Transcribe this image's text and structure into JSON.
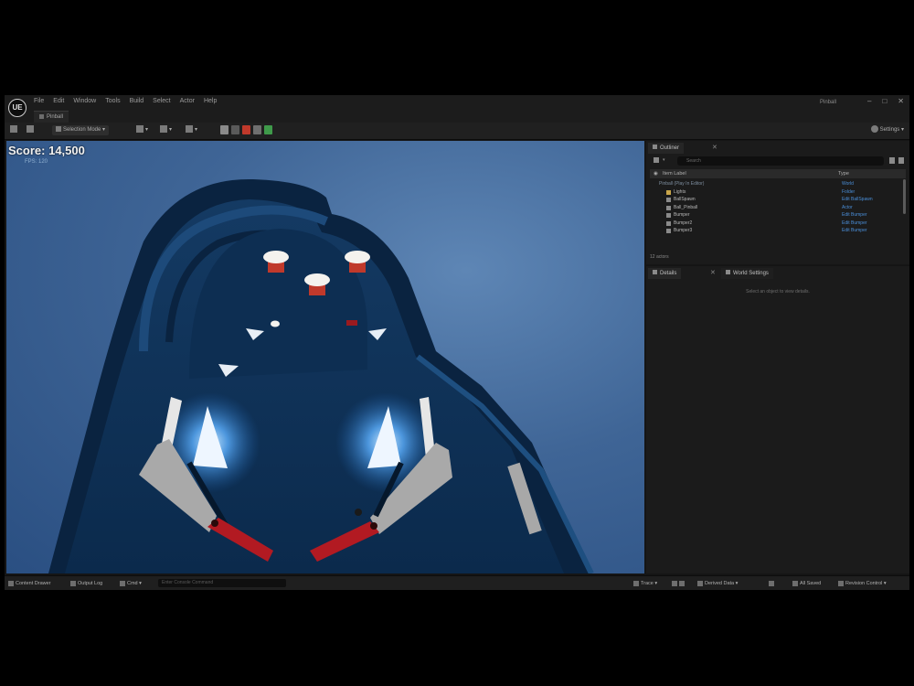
{
  "app": {
    "logo": "UE",
    "menu": [
      "File",
      "Edit",
      "Window",
      "Tools",
      "Build",
      "Select",
      "Actor",
      "Help"
    ],
    "project_tab": "Pinball",
    "project_name": "Pinball",
    "window_controls": [
      "–",
      "□",
      "✕"
    ]
  },
  "toolbar": {
    "mode": "Selection Mode",
    "settings": "Settings"
  },
  "viewport": {
    "score_label": "Score:",
    "score_value": "14,500",
    "fps": "FPS: 120"
  },
  "outliner": {
    "tab": "Outliner",
    "search_placeholder": "Search",
    "col_label": "Item Label",
    "col_type": "Type",
    "rows": [
      {
        "name": "Pinball (Play In Editor)",
        "type": "World"
      },
      {
        "name": "Lights",
        "type": "Folder"
      },
      {
        "name": "BallSpawn",
        "type": "Edit BallSpawn"
      },
      {
        "name": "Ball_Pinball",
        "type": "Actor"
      },
      {
        "name": "Bumper",
        "type": "Edit Bumper"
      },
      {
        "name": "Bumper2",
        "type": "Edit Bumper"
      },
      {
        "name": "Bumper3",
        "type": "Edit Bumper"
      }
    ],
    "actor_count": "12 actors"
  },
  "details": {
    "tab": "Details",
    "tab2": "World Settings",
    "empty_text": "Select an object to view details."
  },
  "statusbar": {
    "content_drawer": "Content Drawer",
    "output_log": "Output Log",
    "cmd": "Cmd",
    "cmd_placeholder": "Enter Console Command",
    "trace": "Trace",
    "derived_data": "Derived Data",
    "all_saved": "All Saved",
    "revision_control": "Revision Control"
  },
  "colors": {
    "viewport_bg": "#3f6596",
    "table": "#0f3358",
    "flipper": "#b21a22",
    "bumper_light": "#eaf4ff",
    "accent": "#4a8ed8"
  }
}
